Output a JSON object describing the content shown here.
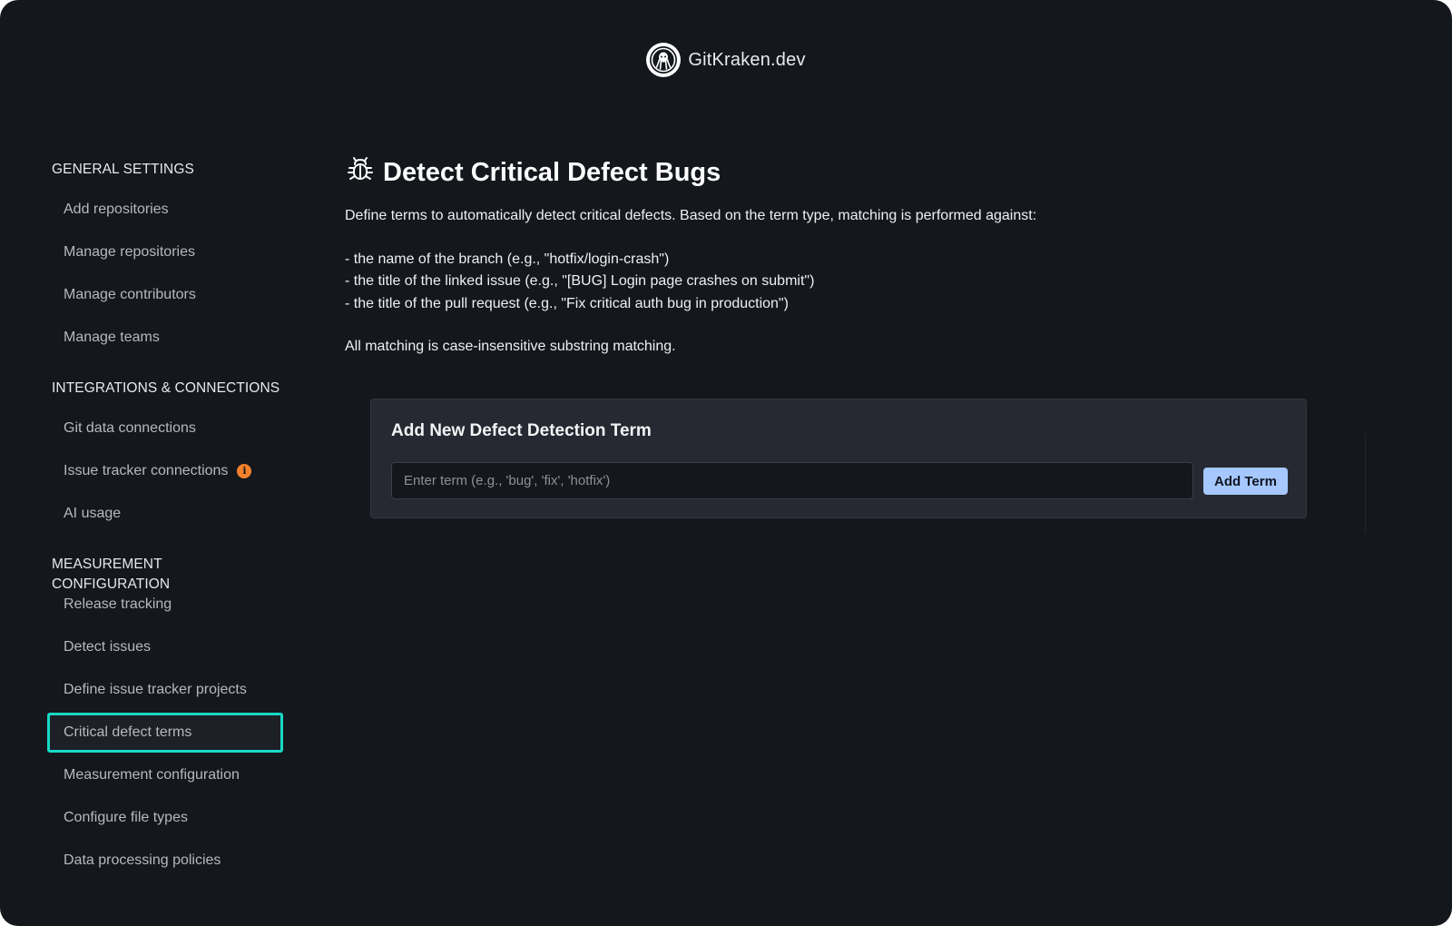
{
  "brand": {
    "name": "GitKraken.dev",
    "logo_icon": "gitkraken-logo-icon"
  },
  "sidebar": {
    "sections": [
      {
        "title": "GENERAL SETTINGS",
        "items": [
          {
            "label": "Add repositories"
          },
          {
            "label": "Manage repositories"
          },
          {
            "label": "Manage contributors"
          },
          {
            "label": "Manage teams"
          }
        ]
      },
      {
        "title": "INTEGRATIONS & CONNECTIONS",
        "items": [
          {
            "label": "Git data connections"
          },
          {
            "label": "Issue tracker connections",
            "badge_icon": "info-icon"
          },
          {
            "label": "AI usage"
          }
        ]
      },
      {
        "title": "MEASUREMENT CONFIGURATION",
        "items": [
          {
            "label": "Release tracking"
          },
          {
            "label": "Detect issues"
          },
          {
            "label": "Define issue tracker projects"
          },
          {
            "label": "Critical defect terms",
            "active": true
          },
          {
            "label": "Measurement configuration"
          },
          {
            "label": "Configure file types"
          },
          {
            "label": "Data processing policies"
          }
        ]
      }
    ]
  },
  "main": {
    "title": "Detect Critical Defect Bugs",
    "title_icon": "bug-icon",
    "intro": "Define terms to automatically detect critical defects. Based on the term type, matching is performed against:",
    "bullets": [
      "- the name of the branch (e.g., \"hotfix/login-crash\")",
      "- the title of the linked issue (e.g., \"[BUG] Login page crashes on submit\")",
      "- the title of the pull request (e.g., \"Fix critical auth bug in production\")"
    ],
    "note": "All matching is case-insensitive substring matching.",
    "card": {
      "title": "Add New Defect Detection Term",
      "input_value": "",
      "input_placeholder": "Enter term (e.g., 'bug', 'fix', 'hotfix')",
      "button_label": "Add Term"
    }
  },
  "colors": {
    "background": "#14171c",
    "active_outline": "#19d9c6",
    "button": "#a6c8ff",
    "info_badge": "#f3812c",
    "card": "#262931"
  }
}
